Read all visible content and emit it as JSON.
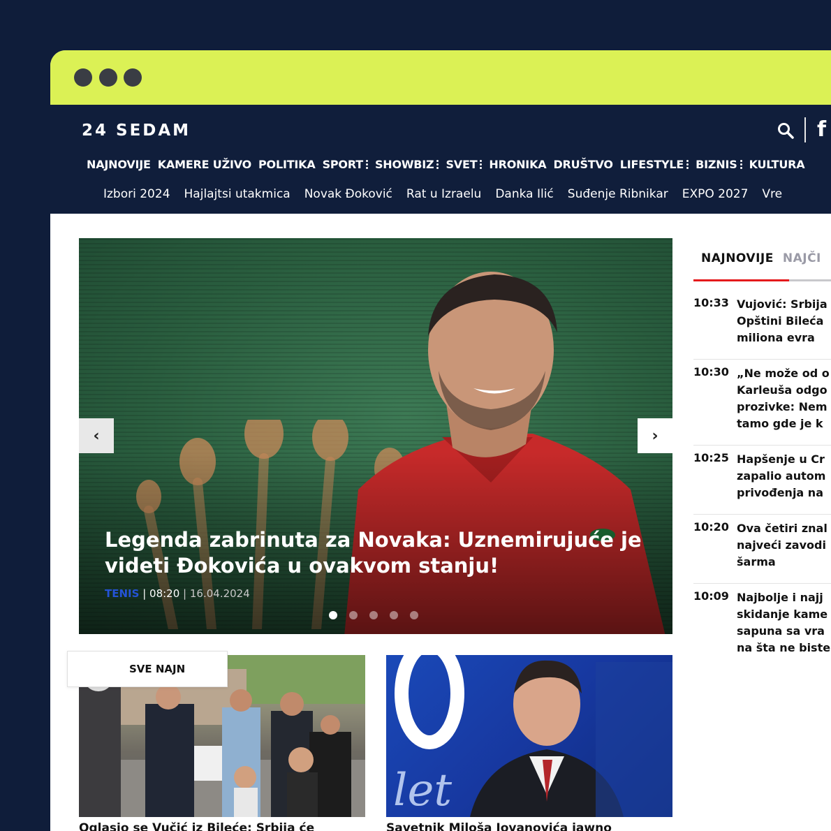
{
  "site": {
    "logo": "24 SEDAM",
    "fb_label": "f"
  },
  "nav": {
    "items": [
      {
        "label": "NAJNOVIJE",
        "submenu": false
      },
      {
        "label": "KAMERE UŽIVO",
        "submenu": false
      },
      {
        "label": "POLITIKA",
        "submenu": false
      },
      {
        "label": "SPORT",
        "submenu": true
      },
      {
        "label": "SHOWBIZ",
        "submenu": true
      },
      {
        "label": "SVET",
        "submenu": true
      },
      {
        "label": "HRONIKA",
        "submenu": false
      },
      {
        "label": "DRUŠTVO",
        "submenu": false
      },
      {
        "label": "LIFESTYLE",
        "submenu": true
      },
      {
        "label": "BIZNIS",
        "submenu": true
      },
      {
        "label": "KULTURA",
        "submenu": false
      }
    ]
  },
  "tags": [
    "Izbori 2024",
    "Hajlajtsi utakmica",
    "Novak Đoković",
    "Rat u Izraelu",
    "Danka Ilić",
    "Suđenje Ribnikar",
    "EXPO 2027",
    "Vre"
  ],
  "hero": {
    "title": "Legenda zabrinuta za Novaka: Uznemirujuće je videti Đokovića u ovakvom stanju!",
    "category": "TENIS",
    "time": "08:20",
    "date": "16.04.2024",
    "slide_count": 5,
    "active_slide": 1,
    "prev_label": "‹",
    "next_label": "›"
  },
  "cards": [
    {
      "caption": "Oglasio se Vučić iz Bileće: Srbija će"
    },
    {
      "caption": "Savetnik Miloša Jovanovića jawno"
    }
  ],
  "sidebar": {
    "tabs": [
      {
        "label": "NAJNOVIJE",
        "active": true
      },
      {
        "label": "NAJČI",
        "active": false
      }
    ],
    "news": [
      {
        "time": "10:33",
        "title": "Vujović: Srbija\nOpštini Bileća\nmiliona evra"
      },
      {
        "time": "10:30",
        "title": "„Ne može od o\nKarleuša odgo\nprozivke: Nem\ntamo gde je k"
      },
      {
        "time": "10:25",
        "title": "Hapšenje u Cr\nzapalio autom\nprivođenja na"
      },
      {
        "time": "10:20",
        "title": "Ova četiri znal\nnajveći zavodi\nšarma"
      },
      {
        "time": "10:09",
        "title": "Najbolje i najj\nskidanje kame\nsapuna sa vra\nna šta ne biste"
      }
    ],
    "all_button": "SVE NAJN"
  },
  "colors": {
    "titlebar": "#dbf155",
    "header": "#101e3b",
    "accent_red": "#e4191c",
    "category_blue": "#2453d6"
  }
}
